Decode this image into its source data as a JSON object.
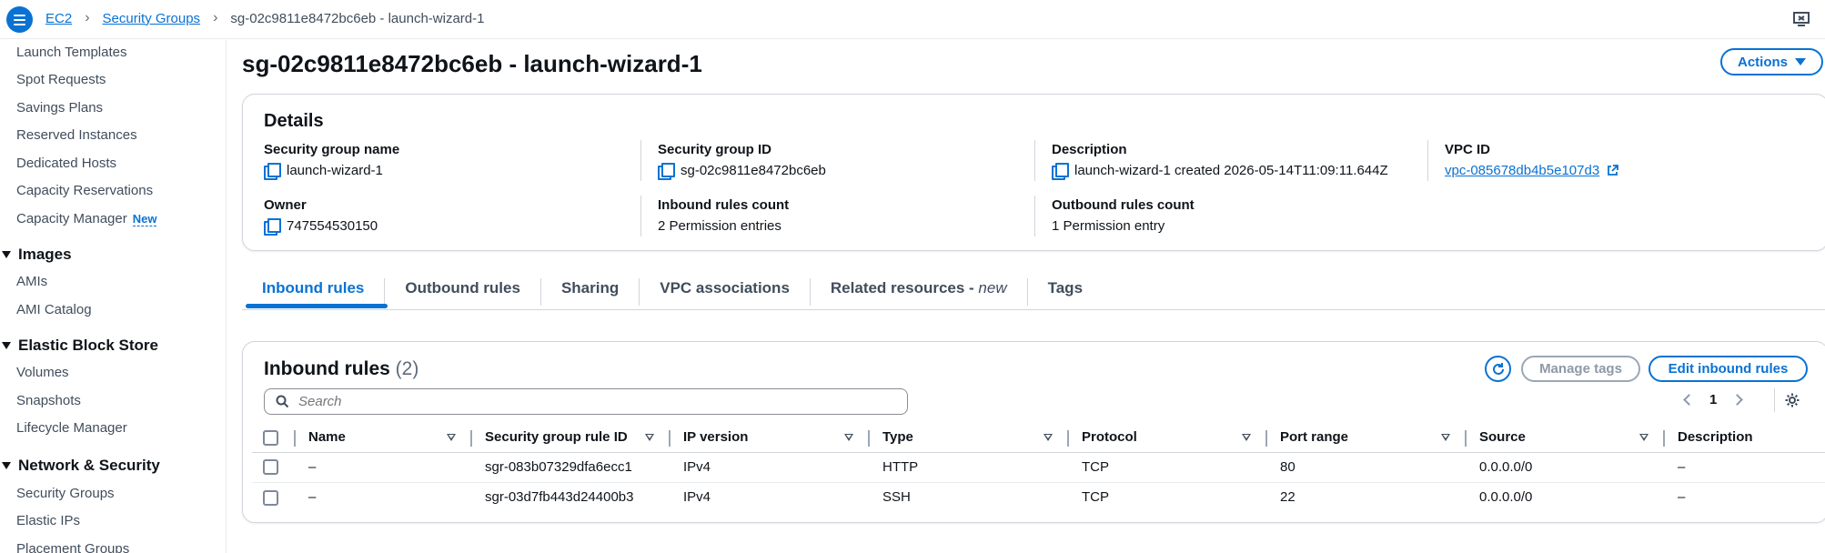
{
  "breadcrumb": {
    "items": [
      "EC2",
      "Security Groups"
    ],
    "current": "sg-02c9811e8472bc6eb - launch-wizard-1"
  },
  "sidebar": {
    "items": [
      {
        "label": "Launch Templates"
      },
      {
        "label": "Spot Requests"
      },
      {
        "label": "Savings Plans"
      },
      {
        "label": "Reserved Instances"
      },
      {
        "label": "Dedicated Hosts"
      },
      {
        "label": "Capacity Reservations"
      },
      {
        "label": "Capacity Manager",
        "badge": "New"
      }
    ],
    "sections": [
      {
        "title": "Images",
        "items": [
          "AMIs",
          "AMI Catalog"
        ]
      },
      {
        "title": "Elastic Block Store",
        "items": [
          "Volumes",
          "Snapshots",
          "Lifecycle Manager"
        ]
      },
      {
        "title": "Network & Security",
        "items": [
          "Security Groups",
          "Elastic IPs",
          "Placement Groups"
        ]
      }
    ]
  },
  "page": {
    "title": "sg-02c9811e8472bc6eb - launch-wizard-1",
    "actions_label": "Actions"
  },
  "details": {
    "title": "Details",
    "fields": {
      "sg_name": {
        "label": "Security group name",
        "value": "launch-wizard-1"
      },
      "sg_id": {
        "label": "Security group ID",
        "value": "sg-02c9811e8472bc6eb"
      },
      "description": {
        "label": "Description",
        "value": "launch-wizard-1 created 2026-05-14T11:09:11.644Z"
      },
      "vpc_id": {
        "label": "VPC ID",
        "value": "vpc-085678db4b5e107d3"
      },
      "owner": {
        "label": "Owner",
        "value": "747554530150"
      },
      "inbound_count": {
        "label": "Inbound rules count",
        "value": "2 Permission entries"
      },
      "outbound_count": {
        "label": "Outbound rules count",
        "value": "1 Permission entry"
      }
    }
  },
  "tabs": {
    "inbound": "Inbound rules",
    "outbound": "Outbound rules",
    "sharing": "Sharing",
    "vpc_assoc": "VPC associations",
    "related": "Related resources - ",
    "related_suffix": "new",
    "tags": "Tags",
    "active": "inbound"
  },
  "inbound_rules": {
    "title": "Inbound rules",
    "count": "(2)",
    "manage_tags_label": "Manage tags",
    "edit_label": "Edit inbound rules",
    "search_placeholder": "Search",
    "page": "1",
    "columns": [
      "Name",
      "Security group rule ID",
      "IP version",
      "Type",
      "Protocol",
      "Port range",
      "Source",
      "Description"
    ],
    "rows": [
      {
        "name": "–",
        "rule_id": "sgr-083b07329dfa6ecc1",
        "ip_version": "IPv4",
        "type": "HTTP",
        "protocol": "TCP",
        "port_range": "80",
        "source": "0.0.0.0/0",
        "description": "–"
      },
      {
        "name": "–",
        "rule_id": "sgr-03d7fb443d24400b3",
        "ip_version": "IPv4",
        "type": "SSH",
        "protocol": "TCP",
        "port_range": "22",
        "source": "0.0.0.0/0",
        "description": "–"
      }
    ]
  },
  "colors": {
    "accent": "#0972d3",
    "text": "#0f141a",
    "muted": "#5f6b7a",
    "border": "#d1d5db"
  }
}
